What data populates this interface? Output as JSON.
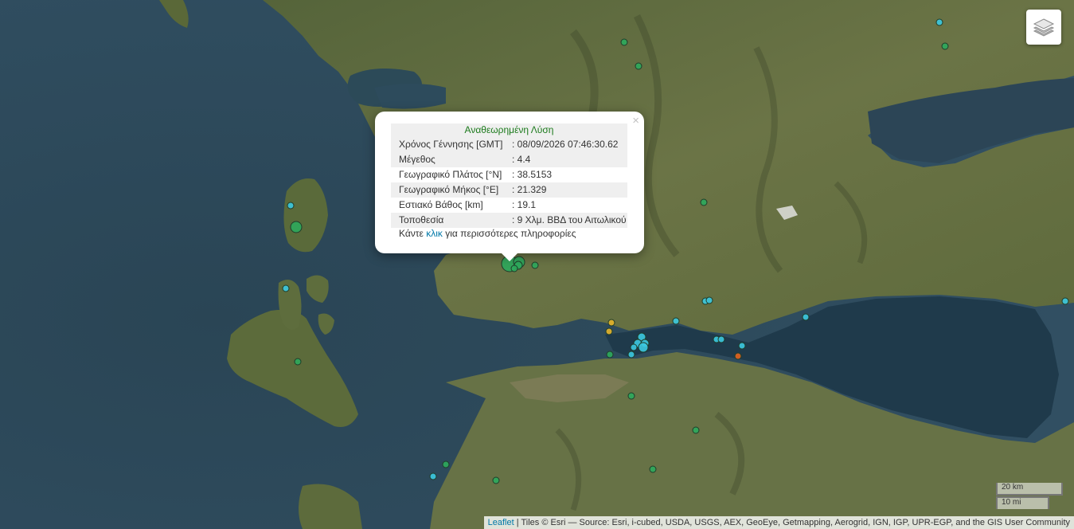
{
  "map": {
    "layers_control_icon": "layers-icon",
    "scale": {
      "metric": "20 km",
      "imperial": "10 mi"
    },
    "attribution": {
      "leaflet_link": "Leaflet",
      "text": "| Tiles © Esri — Source: Esri, i-cubed, USDA, USGS, AEX, GeoEye, Getmapping, Aerogrid, IGN, IGP, UPR-EGP, and the GIS User Community"
    }
  },
  "popup": {
    "close": "×",
    "title": "Αναθεωρημένη Λύση",
    "rows": [
      {
        "label": "Χρόνος Γέννησης [GMT]",
        "value": ": 08/09/2026 07:46:30.62"
      },
      {
        "label": "Μέγεθος",
        "value": ": 4.4"
      },
      {
        "label": "Γεωγραφικό Πλάτος [°N]",
        "value": ": 38.5153"
      },
      {
        "label": "Γεωγραφικό Μήκος [°E]",
        "value": ": 21.329"
      },
      {
        "label": "Εστιακό Βάθος [km]",
        "value": ": 19.1"
      },
      {
        "label": "Τοποθεσία",
        "value": ": 9 Χλμ. ΒΒΔ του Αιτωλικού"
      }
    ],
    "more_prefix": "Κάντε ",
    "more_link": "κλικ",
    "more_suffix": " για περισσότερες πληροφορίες"
  },
  "colors": {
    "sea": "#2e4a5c",
    "land": "#5d6c3e",
    "marker_green": "#2eaa5c",
    "marker_cyan": "#3cc9e0",
    "marker_yellow": "#e4b42a",
    "marker_orange": "#e2631e"
  }
}
